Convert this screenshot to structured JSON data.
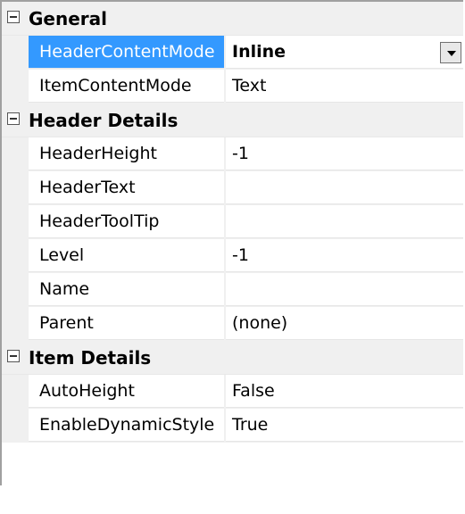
{
  "categories": [
    {
      "label": "General",
      "rows": [
        {
          "name": "HeaderContentMode",
          "value": "Inline",
          "selected": true,
          "dropdown": true
        },
        {
          "name": "ItemContentMode",
          "value": "Text"
        }
      ]
    },
    {
      "label": "Header Details",
      "rows": [
        {
          "name": "HeaderHeight",
          "value": "-1"
        },
        {
          "name": "HeaderText",
          "value": ""
        },
        {
          "name": "HeaderToolTip",
          "value": ""
        },
        {
          "name": "Level",
          "value": "-1"
        },
        {
          "name": "Name",
          "value": ""
        },
        {
          "name": "Parent",
          "value": "(none)"
        }
      ]
    },
    {
      "label": "Item Details",
      "rows": [
        {
          "name": "AutoHeight",
          "value": "False"
        },
        {
          "name": "EnableDynamicStyle",
          "value": "True"
        }
      ]
    }
  ]
}
